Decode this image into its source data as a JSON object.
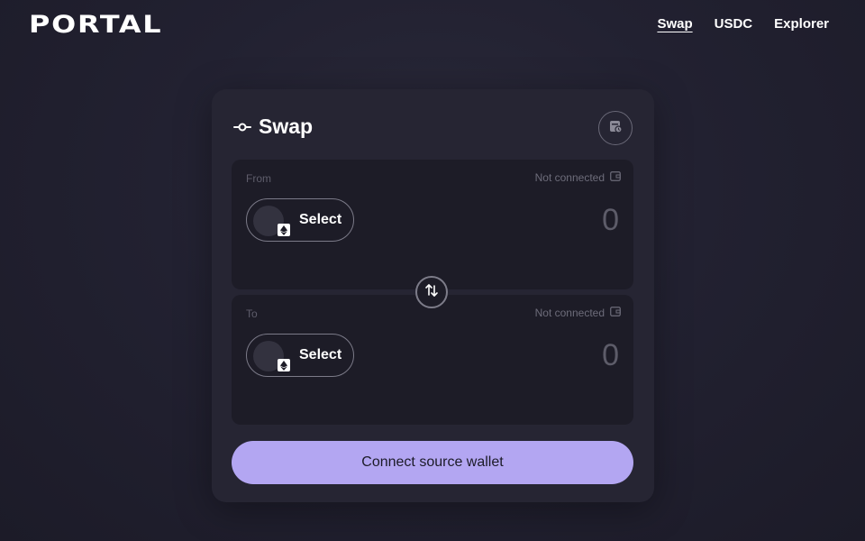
{
  "brand": {
    "logo_text": "PORTAL"
  },
  "nav": {
    "items": [
      {
        "label": "Swap",
        "active": true
      },
      {
        "label": "USDC",
        "active": false
      },
      {
        "label": "Explorer",
        "active": false
      }
    ]
  },
  "card": {
    "title": "Swap",
    "title_icon": "commit-icon",
    "history_icon": "wallet-history-icon"
  },
  "from_panel": {
    "label": "From",
    "status": "Not connected",
    "status_icon": "wallet-icon",
    "select_label": "Select",
    "chain_icon": "ethereum-icon",
    "amount": "0"
  },
  "to_panel": {
    "label": "To",
    "status": "Not connected",
    "status_icon": "wallet-icon",
    "select_label": "Select",
    "chain_icon": "ethereum-icon",
    "amount": "0"
  },
  "swap_direction_icon": "swap-arrows-icon",
  "connect_button": {
    "label": "Connect source wallet"
  },
  "colors": {
    "accent": "#b3a6f2",
    "card_bg": "#262533",
    "panel_bg": "#1d1c27",
    "page_bg": "#222131"
  }
}
